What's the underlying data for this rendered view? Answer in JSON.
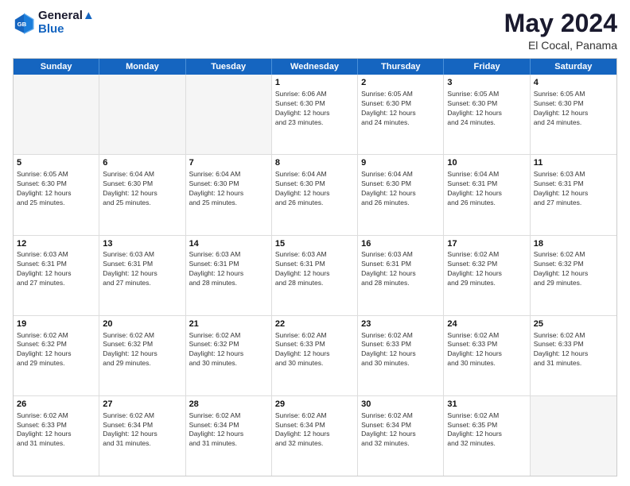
{
  "header": {
    "logo_line1": "General",
    "logo_line2": "Blue",
    "main_title": "May 2024",
    "subtitle": "El Cocal, Panama"
  },
  "days_of_week": [
    "Sunday",
    "Monday",
    "Tuesday",
    "Wednesday",
    "Thursday",
    "Friday",
    "Saturday"
  ],
  "weeks": [
    [
      {
        "day": "",
        "info": ""
      },
      {
        "day": "",
        "info": ""
      },
      {
        "day": "",
        "info": ""
      },
      {
        "day": "1",
        "info": "Sunrise: 6:06 AM\nSunset: 6:30 PM\nDaylight: 12 hours\nand 23 minutes."
      },
      {
        "day": "2",
        "info": "Sunrise: 6:05 AM\nSunset: 6:30 PM\nDaylight: 12 hours\nand 24 minutes."
      },
      {
        "day": "3",
        "info": "Sunrise: 6:05 AM\nSunset: 6:30 PM\nDaylight: 12 hours\nand 24 minutes."
      },
      {
        "day": "4",
        "info": "Sunrise: 6:05 AM\nSunset: 6:30 PM\nDaylight: 12 hours\nand 24 minutes."
      }
    ],
    [
      {
        "day": "5",
        "info": "Sunrise: 6:05 AM\nSunset: 6:30 PM\nDaylight: 12 hours\nand 25 minutes."
      },
      {
        "day": "6",
        "info": "Sunrise: 6:04 AM\nSunset: 6:30 PM\nDaylight: 12 hours\nand 25 minutes."
      },
      {
        "day": "7",
        "info": "Sunrise: 6:04 AM\nSunset: 6:30 PM\nDaylight: 12 hours\nand 25 minutes."
      },
      {
        "day": "8",
        "info": "Sunrise: 6:04 AM\nSunset: 6:30 PM\nDaylight: 12 hours\nand 26 minutes."
      },
      {
        "day": "9",
        "info": "Sunrise: 6:04 AM\nSunset: 6:30 PM\nDaylight: 12 hours\nand 26 minutes."
      },
      {
        "day": "10",
        "info": "Sunrise: 6:04 AM\nSunset: 6:31 PM\nDaylight: 12 hours\nand 26 minutes."
      },
      {
        "day": "11",
        "info": "Sunrise: 6:03 AM\nSunset: 6:31 PM\nDaylight: 12 hours\nand 27 minutes."
      }
    ],
    [
      {
        "day": "12",
        "info": "Sunrise: 6:03 AM\nSunset: 6:31 PM\nDaylight: 12 hours\nand 27 minutes."
      },
      {
        "day": "13",
        "info": "Sunrise: 6:03 AM\nSunset: 6:31 PM\nDaylight: 12 hours\nand 27 minutes."
      },
      {
        "day": "14",
        "info": "Sunrise: 6:03 AM\nSunset: 6:31 PM\nDaylight: 12 hours\nand 28 minutes."
      },
      {
        "day": "15",
        "info": "Sunrise: 6:03 AM\nSunset: 6:31 PM\nDaylight: 12 hours\nand 28 minutes."
      },
      {
        "day": "16",
        "info": "Sunrise: 6:03 AM\nSunset: 6:31 PM\nDaylight: 12 hours\nand 28 minutes."
      },
      {
        "day": "17",
        "info": "Sunrise: 6:02 AM\nSunset: 6:32 PM\nDaylight: 12 hours\nand 29 minutes."
      },
      {
        "day": "18",
        "info": "Sunrise: 6:02 AM\nSunset: 6:32 PM\nDaylight: 12 hours\nand 29 minutes."
      }
    ],
    [
      {
        "day": "19",
        "info": "Sunrise: 6:02 AM\nSunset: 6:32 PM\nDaylight: 12 hours\nand 29 minutes."
      },
      {
        "day": "20",
        "info": "Sunrise: 6:02 AM\nSunset: 6:32 PM\nDaylight: 12 hours\nand 29 minutes."
      },
      {
        "day": "21",
        "info": "Sunrise: 6:02 AM\nSunset: 6:32 PM\nDaylight: 12 hours\nand 30 minutes."
      },
      {
        "day": "22",
        "info": "Sunrise: 6:02 AM\nSunset: 6:33 PM\nDaylight: 12 hours\nand 30 minutes."
      },
      {
        "day": "23",
        "info": "Sunrise: 6:02 AM\nSunset: 6:33 PM\nDaylight: 12 hours\nand 30 minutes."
      },
      {
        "day": "24",
        "info": "Sunrise: 6:02 AM\nSunset: 6:33 PM\nDaylight: 12 hours\nand 30 minutes."
      },
      {
        "day": "25",
        "info": "Sunrise: 6:02 AM\nSunset: 6:33 PM\nDaylight: 12 hours\nand 31 minutes."
      }
    ],
    [
      {
        "day": "26",
        "info": "Sunrise: 6:02 AM\nSunset: 6:33 PM\nDaylight: 12 hours\nand 31 minutes."
      },
      {
        "day": "27",
        "info": "Sunrise: 6:02 AM\nSunset: 6:34 PM\nDaylight: 12 hours\nand 31 minutes."
      },
      {
        "day": "28",
        "info": "Sunrise: 6:02 AM\nSunset: 6:34 PM\nDaylight: 12 hours\nand 31 minutes."
      },
      {
        "day": "29",
        "info": "Sunrise: 6:02 AM\nSunset: 6:34 PM\nDaylight: 12 hours\nand 32 minutes."
      },
      {
        "day": "30",
        "info": "Sunrise: 6:02 AM\nSunset: 6:34 PM\nDaylight: 12 hours\nand 32 minutes."
      },
      {
        "day": "31",
        "info": "Sunrise: 6:02 AM\nSunset: 6:35 PM\nDaylight: 12 hours\nand 32 minutes."
      },
      {
        "day": "",
        "info": ""
      }
    ]
  ]
}
